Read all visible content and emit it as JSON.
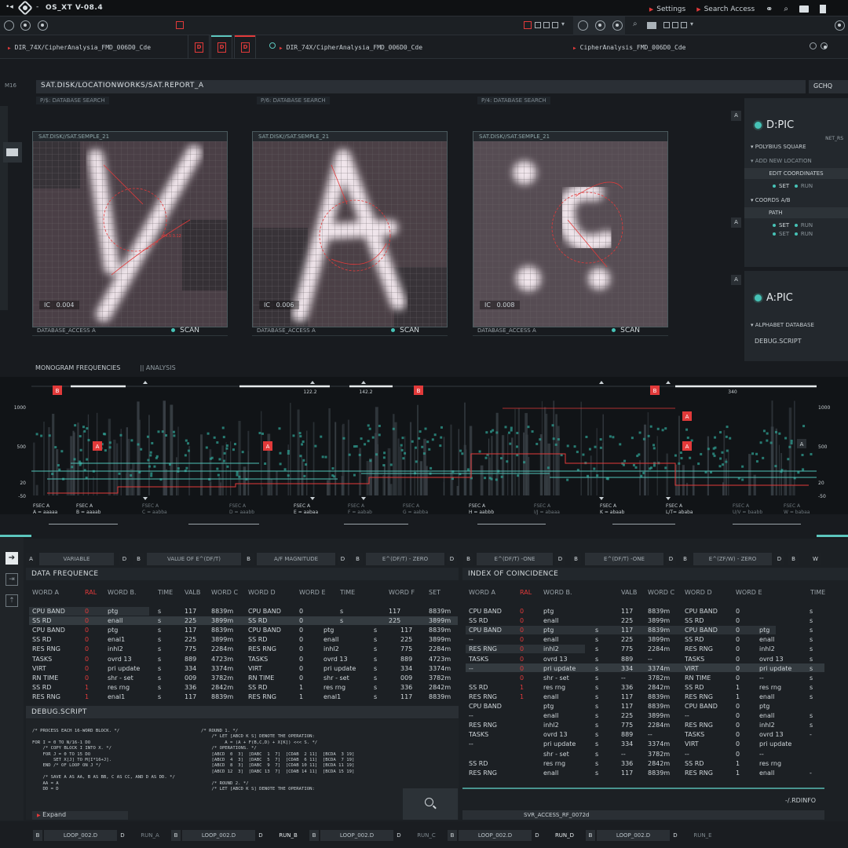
{
  "app": {
    "title": "OS_XT V-08.4",
    "menu_settings": "Settings",
    "menu_search": "Search Access"
  },
  "tabs": {
    "path_left": "DIR_74X/CipherAnalysia_FMD_006D0_Cde",
    "path_mid": "DIR_74X/CipherAnalysia_FMD_006D0_Cde",
    "path_right": "CipherAnalysis_FMD_006D0_Cde",
    "doc_badge": "D"
  },
  "header": {
    "side_code": "M16",
    "location": "SAT.DISK/LOCATIONWORKS/SAT.REPORT_A",
    "right": "GCHQ"
  },
  "panels": [
    {
      "sub": "P/$: DATABASE SEARCH",
      "title": "SAT.DISK//SAT.SEMPLE_21",
      "ic_label": "IC",
      "ic": "0.004",
      "foot": "DATABASE_ACCESS A",
      "scan": "SCAN",
      "glyph": "X"
    },
    {
      "sub": "P/6: DATABASE SEARCH",
      "title": "SAT.DISK//SAT.SEMPLE_21",
      "ic_label": "IC",
      "ic": "0.006",
      "foot": "DATABASE_ACCESS A",
      "scan": "SCAN",
      "glyph": "A"
    },
    {
      "sub": "P/4: DATABASE SEARCH",
      "title": "SAT.DISK//SAT.SEMPLE_21",
      "ic_label": "IC",
      "ic": "0.008",
      "foot": "DATABASE_ACCESS A",
      "scan": "SCAN",
      "glyph": "C"
    }
  ],
  "right_panel": {
    "badge": "A",
    "dpic": "D:PIC",
    "net": "NET_RS",
    "polybius": "POLYBIUS SQUARE",
    "add_location": "ADD NEW LOCATION",
    "edit_coords": "EDIT COORDINATES",
    "set": "SET",
    "run": "RUN",
    "coords": "COORDS A/B",
    "path": "PATH",
    "apic": "A:PIC",
    "alphabet": "ALPHABET DATABASE",
    "debug": "DEBUG.SCRIPT"
  },
  "monogram": {
    "title": "MONOGRAM FREQUENCIES",
    "analysis": "|| ANALYSIS"
  },
  "chart_data": {
    "type": "bar",
    "title": "",
    "y_ticks": [
      1000,
      500,
      20,
      -50
    ],
    "top_labels": [
      "122.2",
      "142.2",
      "340"
    ],
    "marker_B": "B",
    "marker_A": "A",
    "x_groups": [
      {
        "name": "FSEC A",
        "value": "A = aaaaa"
      },
      {
        "name": "FSEC A",
        "value": "B = aaaab"
      },
      {
        "name": "FSEC A",
        "value": "C = aabba"
      },
      {
        "name": "FSEC A",
        "value": "D = aaabb"
      },
      {
        "name": "FSEC A",
        "value": "E = aabaa"
      },
      {
        "name": "FSEC A",
        "value": "F = aabab"
      },
      {
        "name": "FSEC A",
        "value": "G = aabba"
      },
      {
        "name": "FSEC A",
        "value": "H = aabbb"
      },
      {
        "name": "FSEC A",
        "value": "I/J = abaaa"
      },
      {
        "name": "FSEC A",
        "value": "K = abaab"
      },
      {
        "name": "FSEC A",
        "value": "L/T= ababa"
      },
      {
        "name": "FSEC A",
        "value": "U/V = baabb"
      },
      {
        "name": "FSEC A",
        "value": "W = babaa"
      }
    ]
  },
  "columns": [
    "VARIABLE",
    "VALUE OF E^(DF/T)",
    "A/F MAGNITUDE",
    "E^(DF/T) - ZERO",
    "E^(DF/T) -ONE",
    "E^(DF/T) -ONE",
    "E^(ZF/W) - ZERO"
  ],
  "col_badges": {
    "a": "A",
    "b": "B",
    "d": "D",
    "w": "W"
  },
  "data_freq": {
    "title": "DATA FREQUENCE",
    "headers": [
      "WORD A",
      "RAL",
      "WORD B.",
      "TIME",
      "VALB",
      "WORD C",
      "WORD D",
      "WORD E",
      "TIME",
      "WORD F",
      "SET"
    ],
    "rows": [
      [
        "CPU BAND",
        "0",
        "ptg",
        "s",
        "117",
        "8839m",
        "CPU BAND",
        "0",
        "s",
        "117",
        "8839m"
      ],
      [
        "SS RD",
        "0",
        "enall",
        "s",
        "225",
        "3899m",
        "SS RD",
        "0",
        "s",
        "225",
        "3899m"
      ],
      [
        "CPU BAND",
        "0",
        "ptg",
        "s",
        "117",
        "8839m",
        "CPU BAND",
        "0",
        "ptg",
        "s",
        "117",
        "8839m"
      ],
      [
        "SS RD",
        "0",
        "enal1",
        "s",
        "225",
        "3899m",
        "SS RD",
        "0",
        "enall",
        "s",
        "225",
        "3899m"
      ],
      [
        "RES RNG",
        "0",
        "inhl2",
        "s",
        "775",
        "2284m",
        "RES RNG",
        "0",
        "inhl2",
        "s",
        "775",
        "2284m"
      ],
      [
        "TASKS",
        "0",
        "ovrd   13",
        "s",
        "889",
        "4723m",
        "TASKS",
        "0",
        "ovrd   13",
        "s",
        "889",
        "4723m"
      ],
      [
        "VIRT",
        "0",
        "pri update",
        "s",
        "334",
        "3374m",
        "VIRT",
        "0",
        "pri update",
        "s",
        "334",
        "3374m"
      ],
      [
        "RN TIME",
        "0",
        "shr - set",
        "s",
        "009",
        "3782m",
        "RN TIME",
        "0",
        "shr - set",
        "s",
        "009",
        "3782m"
      ],
      [
        "SS RD",
        "1",
        "res rng",
        "s",
        "336",
        "2842m",
        "SS RD",
        "1",
        "res rng",
        "s",
        "336",
        "2842m"
      ],
      [
        "RES RNG",
        "1",
        "enal1",
        "s",
        "117",
        "8839m",
        "RES RNG",
        "1",
        "enal1",
        "s",
        "117",
        "8839m"
      ]
    ]
  },
  "coincidence": {
    "title": "INDEX OF COINCIDENCE",
    "headers": [
      "WORD A",
      "RAL",
      "WORD B.",
      "VALB",
      "WORD C",
      "WORD D",
      "WORD E",
      "TIME"
    ],
    "rows": [
      [
        "CPU BAND",
        "0",
        "ptg",
        "",
        "117",
        "8839m",
        "CPU BAND",
        "0",
        "",
        "s"
      ],
      [
        "SS RD",
        "0",
        "enall",
        "",
        "225",
        "3899m",
        "SS RD",
        "0",
        "",
        "s"
      ],
      [
        "CPU BAND",
        "0",
        "ptg",
        "s",
        "117",
        "8839m",
        "CPU BAND",
        "0",
        "ptg",
        "s"
      ],
      [
        "--",
        "0",
        "enall",
        "s",
        "225",
        "3899m",
        "SS RD",
        "0",
        "enall",
        "s"
      ],
      [
        "RES RNG",
        "0",
        "inhl2",
        "s",
        "775",
        "2284m",
        "RES RNG",
        "0",
        "inhl2",
        "s"
      ],
      [
        "TASKS",
        "0",
        "ovrd   13",
        "s",
        "889",
        "--",
        "TASKS",
        "0",
        "ovrd   13",
        "s"
      ],
      [
        "--",
        "0",
        "pri update",
        "s",
        "334",
        "3374m",
        "VIRT",
        "0",
        "pri update",
        "s"
      ],
      [
        "",
        "0",
        "shr - set",
        "s",
        "--",
        "3782m",
        "RN TIME",
        "0",
        "--",
        "s"
      ],
      [
        "SS RD",
        "1",
        "res rng",
        "s",
        "336",
        "2842m",
        "SS RD",
        "1",
        "res rng",
        "s"
      ],
      [
        "RES RNG",
        "1",
        "enall",
        "s",
        "117",
        "8839m",
        "RES RNG",
        "1",
        "enall",
        "s"
      ],
      [
        "CPU BAND",
        "",
        "ptg",
        "s",
        "117",
        "8839m",
        "CPU BAND",
        "0",
        "ptg",
        ""
      ],
      [
        "--",
        "",
        "enall",
        "s",
        "225",
        "3899m",
        "--",
        "0",
        "enall",
        "s"
      ],
      [
        "RES RNG",
        "",
        "inhl2",
        "s",
        "775",
        "2284m",
        "RES RNG",
        "0",
        "inhl2",
        "s"
      ],
      [
        "TASKS",
        "",
        "ovrd   13",
        "s",
        "889",
        "--",
        "TASKS",
        "0",
        "ovrd   13",
        "-"
      ],
      [
        "--",
        "",
        "pri update",
        "s",
        "334",
        "3374m",
        "VIRT",
        "0",
        "pri update",
        ""
      ],
      [
        "",
        "",
        "shr - set",
        "s",
        "--",
        "3782m",
        "--",
        "0",
        "--",
        ""
      ],
      [
        "SS RD",
        "",
        "res rng",
        "s",
        "336",
        "2842m",
        "SS RD",
        "1",
        "res rng",
        ""
      ],
      [
        "RES RNG",
        "",
        "enall",
        "s",
        "117",
        "8839m",
        "RES RNG",
        "1",
        "enall",
        "-"
      ]
    ]
  },
  "debug": {
    "title": "DEBUG.SCRIPT",
    "code_left": "/* PROCESS EACH 16-WORD BLOCK. */\n\nFOR I = 0 TO N/16-1 DO\n    /* COPY BLOCK I INTO X. */\n    FOR J = 0 TO 15 DO\n        SET X[J] TO M[I*16+J].\n    END /* OF LOOP ON J */\n\n    /* SAVE A AS AA, B AS BB, C AS CC, AND D AS DD. */\n    AA = A\n    DD = D",
    "code_right": "/* ROUND 1. */\n    /* LET [ABCD K S] DENOTE THE OPERATION:\n         A = (A + F(B,C,D) + X[K]) <<< S. */\n    /* OPERATIONS. */\n    [ABCD  0  3]  [DABC  1  7]  [CDAB  2 11]  [BCDA  3 19]\n    [ABCD  4  3]  [DABC  5  7]  [CDAB  6 11]  [BCDA  7 19]\n    [ABCD  8  3]  [DABC  9  7]  [CDAB 10 11]  [BCDA 11 19]\n    [ABCD 12  3]  [DABC 13  7]  [CDAB 14 11]  [BCDA 15 19]\n\n    /* ROUND 2. */\n    /* LET [ABCD K S] DENOTE THE OPERATION:",
    "expand": "Expand"
  },
  "rdinfo": {
    "label": "-/.RDINFO",
    "server": "SVR_ACCESS_RF_0072d"
  },
  "footer": {
    "badge_b": "B",
    "badge_d": "D",
    "loop": "LOOP_002.D",
    "runs": [
      "RUN_A",
      "RUN_B",
      "RUN_C",
      "RUN_D",
      "RUN_E"
    ]
  }
}
